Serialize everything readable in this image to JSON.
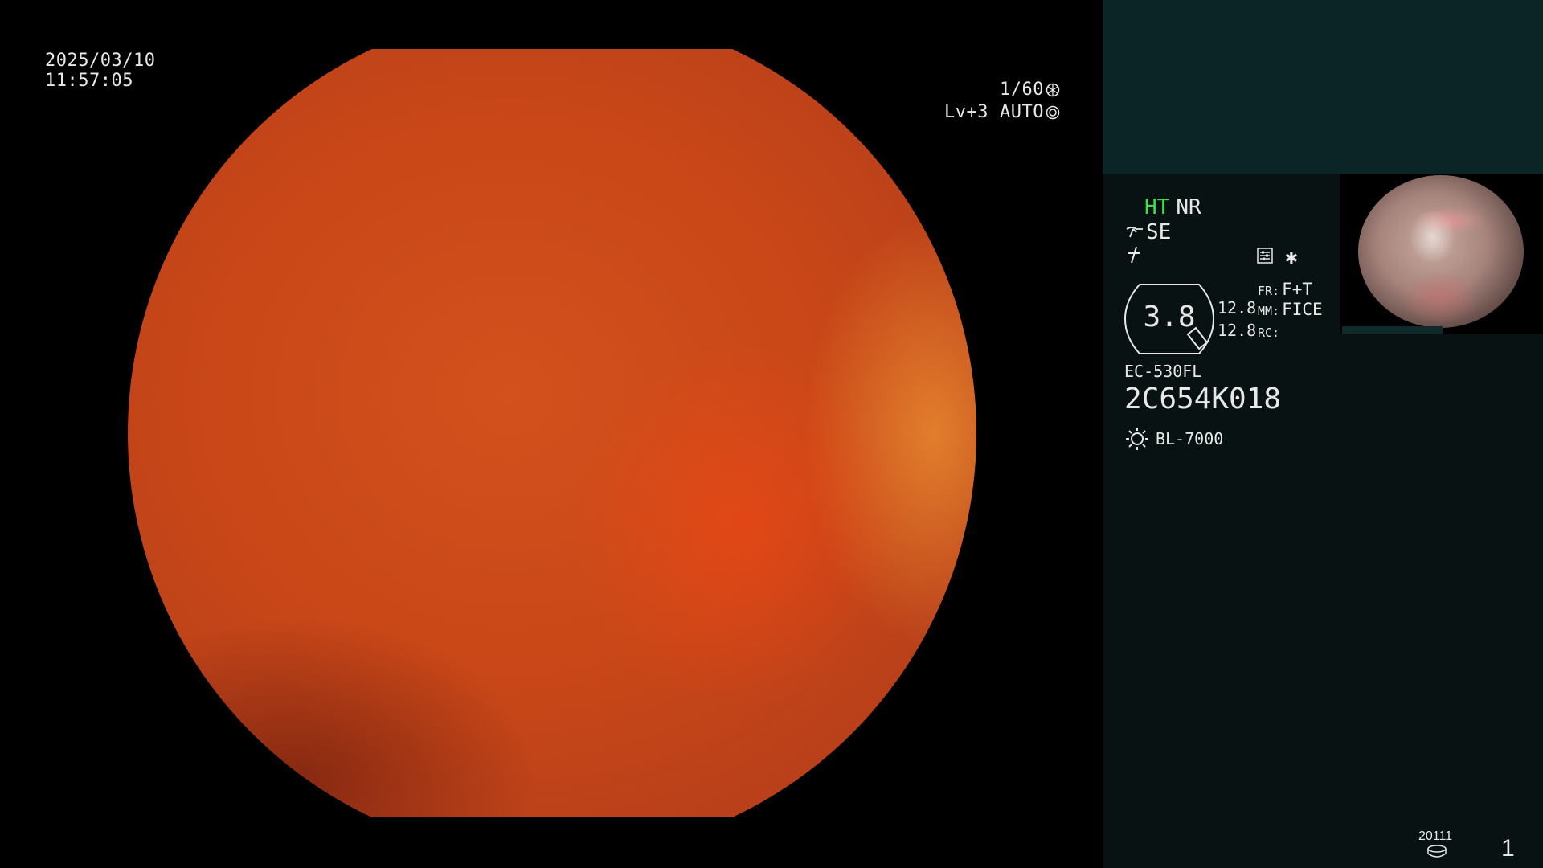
{
  "main": {
    "date": "2025/03/10",
    "time": "11:57:05",
    "shutter": "1/60",
    "level": "Lv+3",
    "exposure_mode": "AUTO",
    "image_color": "#c94718"
  },
  "panel": {
    "ht": "HT",
    "nr": "NR",
    "se": "SE",
    "zoom": "3.8",
    "values": [
      "12.8",
      "12.8"
    ],
    "params": [
      {
        "key": "FR:",
        "value": "F+T"
      },
      {
        "key": "MM:",
        "value": "FICE"
      },
      {
        "key": "RC:",
        "value": ""
      }
    ],
    "scope_model": "EC-530FL",
    "scope_serial": "2C654K018",
    "light_source": "BL-7000",
    "colors": {
      "ht": "#3fe04b",
      "panel_bg": "#081212",
      "top_bg": "#0b2426"
    }
  },
  "thumbnail": {
    "icons": [
      "mini-endoscope-image"
    ]
  },
  "footer": {
    "disk_label": "20111",
    "page_number": "1"
  },
  "icons": {
    "shutter": "aperture-icon",
    "auto": "iris-icon",
    "se": "scope-tip-icon",
    "f": "freeze-icon",
    "menu": "settings-list-icon",
    "star": "asterisk-icon",
    "light": "lamp-icon",
    "disk": "storage-disk-icon"
  }
}
